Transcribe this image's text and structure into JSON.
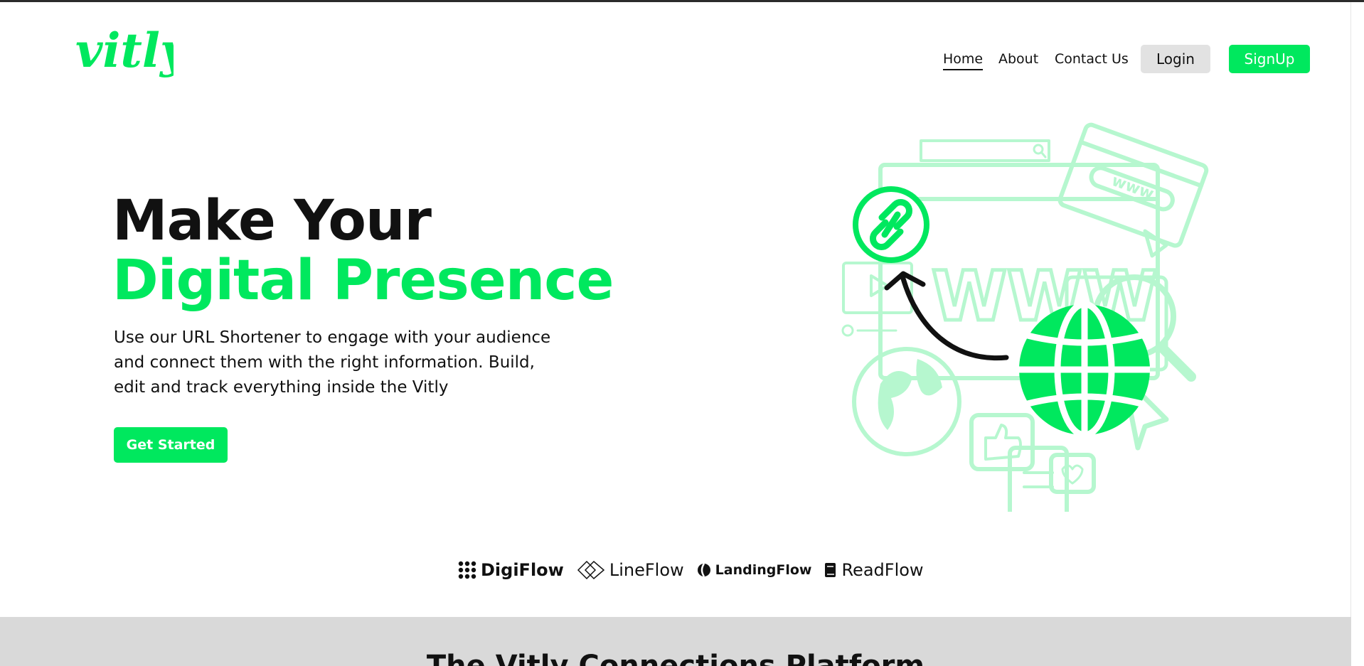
{
  "brand": {
    "logo_text": "vitly",
    "accent": "#00e85e"
  },
  "nav": {
    "items": [
      {
        "label": "Home",
        "active": true
      },
      {
        "label": "About",
        "active": false
      },
      {
        "label": "Contact Us",
        "active": false
      }
    ],
    "login_label": "Login",
    "signup_label": "SignUp"
  },
  "hero": {
    "title_line1": "Make Your",
    "title_line2": "Digital Presence",
    "description": "Use our URL Shortener to engage with your audience and connect them with the right information. Build, edit and track everything inside the Vitly",
    "cta_label": "Get Started",
    "illustration_text": "www."
  },
  "partners": [
    {
      "name": "DigiFlow",
      "icon": "dots-grid-icon"
    },
    {
      "name": "LineFlow",
      "icon": "diamond-outline-icon"
    },
    {
      "name": "LandingFlow",
      "icon": "swirl-icon"
    },
    {
      "name": "ReadFlow",
      "icon": "book-icon"
    }
  ],
  "section": {
    "title": "The Vitly Connections Platform"
  }
}
